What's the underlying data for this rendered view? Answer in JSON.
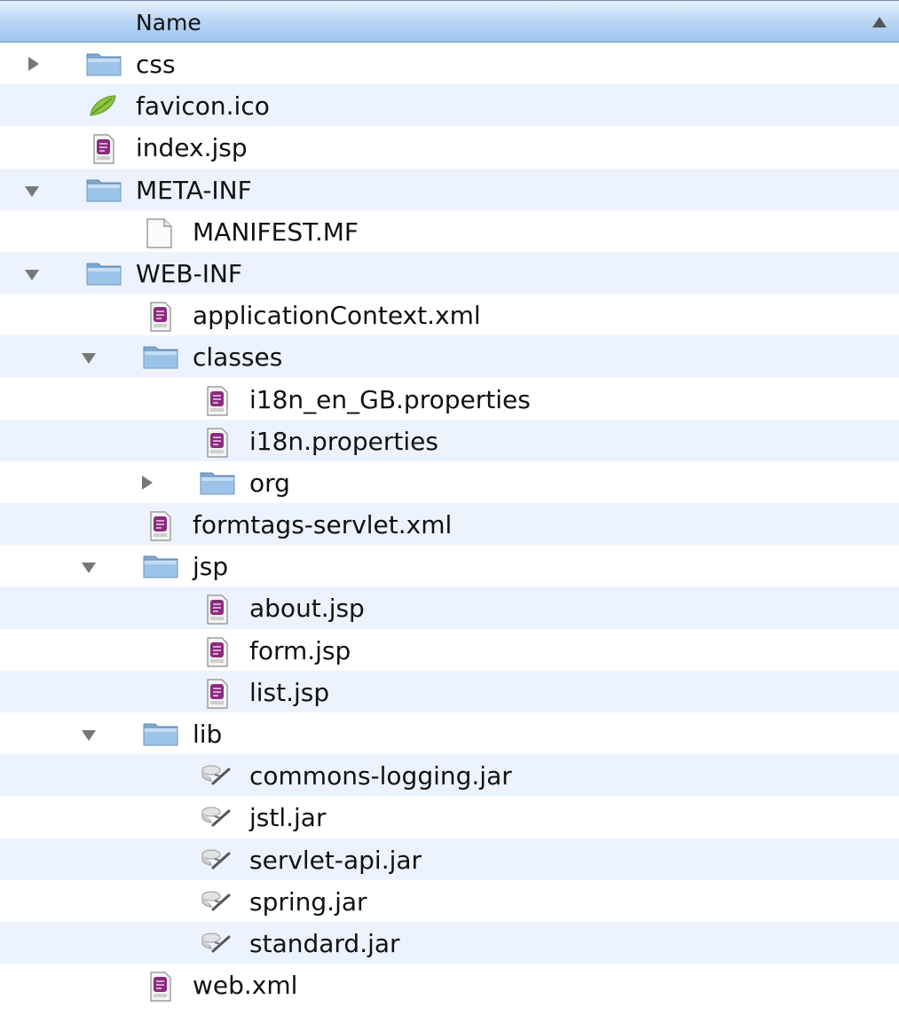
{
  "header": {
    "column_label": "Name"
  },
  "tree": [
    {
      "label": "css",
      "icon": "folder-icon",
      "depth": 0,
      "toggle": "collapsed"
    },
    {
      "label": "favicon.ico",
      "icon": "leaf-icon",
      "depth": 0,
      "toggle": "none"
    },
    {
      "label": "index.jsp",
      "icon": "jsp-file-icon",
      "depth": 0,
      "toggle": "none"
    },
    {
      "label": "META-INF",
      "icon": "folder-icon",
      "depth": 0,
      "toggle": "expanded"
    },
    {
      "label": "MANIFEST.MF",
      "icon": "document-icon",
      "depth": 1,
      "toggle": "none"
    },
    {
      "label": "WEB-INF",
      "icon": "folder-icon",
      "depth": 0,
      "toggle": "expanded"
    },
    {
      "label": "applicationContext.xml",
      "icon": "xml-file-icon",
      "depth": 1,
      "toggle": "none"
    },
    {
      "label": "classes",
      "icon": "folder-icon",
      "depth": 1,
      "toggle": "expanded"
    },
    {
      "label": "i18n_en_GB.properties",
      "icon": "java-file-icon",
      "depth": 2,
      "toggle": "none"
    },
    {
      "label": "i18n.properties",
      "icon": "java-file-icon",
      "depth": 2,
      "toggle": "none"
    },
    {
      "label": "org",
      "icon": "folder-icon",
      "depth": 2,
      "toggle": "collapsed"
    },
    {
      "label": "formtags-servlet.xml",
      "icon": "xml-file-icon",
      "depth": 1,
      "toggle": "none"
    },
    {
      "label": "jsp",
      "icon": "folder-icon",
      "depth": 1,
      "toggle": "expanded"
    },
    {
      "label": "about.jsp",
      "icon": "jsp-file-icon",
      "depth": 2,
      "toggle": "none"
    },
    {
      "label": "form.jsp",
      "icon": "jsp-file-icon",
      "depth": 2,
      "toggle": "none"
    },
    {
      "label": "list.jsp",
      "icon": "jsp-file-icon",
      "depth": 2,
      "toggle": "none"
    },
    {
      "label": "lib",
      "icon": "folder-icon",
      "depth": 1,
      "toggle": "expanded"
    },
    {
      "label": "commons-logging.jar",
      "icon": "jar-icon",
      "depth": 2,
      "toggle": "none"
    },
    {
      "label": "jstl.jar",
      "icon": "jar-icon",
      "depth": 2,
      "toggle": "none"
    },
    {
      "label": "servlet-api.jar",
      "icon": "jar-icon",
      "depth": 2,
      "toggle": "none"
    },
    {
      "label": "spring.jar",
      "icon": "jar-icon",
      "depth": 2,
      "toggle": "none"
    },
    {
      "label": "standard.jar",
      "icon": "jar-icon",
      "depth": 2,
      "toggle": "none"
    },
    {
      "label": "web.xml",
      "icon": "xml-file-icon",
      "depth": 1,
      "toggle": "none"
    }
  ],
  "colors": {
    "folder_blue": "#9cc4e8",
    "row_alt": "#edf3fe",
    "header_blue": "#b8d6f5",
    "jsp_purple": "#8a2b7e",
    "leaf_green": "#8cc63f"
  }
}
